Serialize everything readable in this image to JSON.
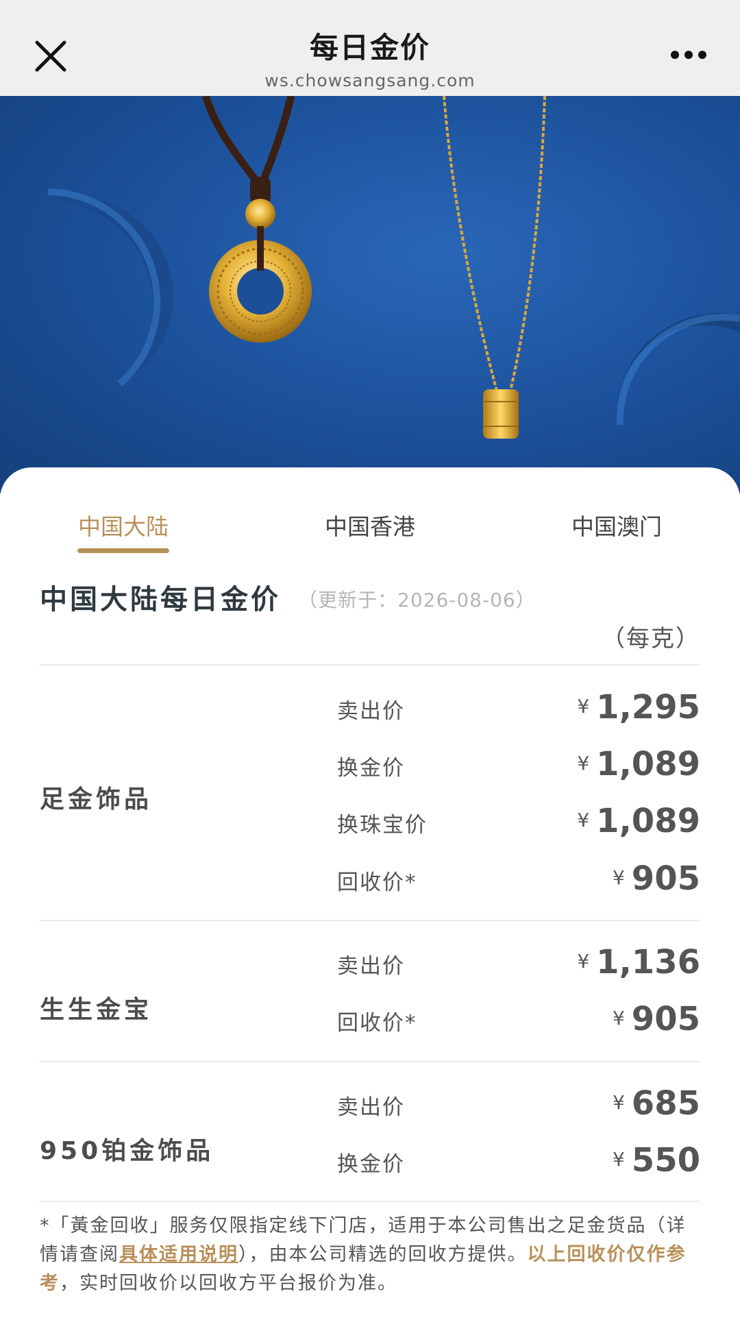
{
  "topbar": {
    "title": "每日金价",
    "url": "ws.chowsangsang.com"
  },
  "tabs": [
    "中国大陆",
    "中国香港",
    "中国澳门"
  ],
  "section": {
    "title": "中国大陆每日金价",
    "update_note": "（更新于：2026-08-06）",
    "unit_note": "（每克）"
  },
  "currency_symbol": "¥",
  "groups": [
    {
      "name": "足金饰品",
      "prices": [
        {
          "label": "卖出价",
          "value": "1,295"
        },
        {
          "label": "换金价",
          "value": "1,089"
        },
        {
          "label": "换珠宝价",
          "value": "1,089"
        },
        {
          "label": "回收价*",
          "value": "905"
        }
      ]
    },
    {
      "name": "生生金宝",
      "prices": [
        {
          "label": "卖出价",
          "value": "1,136"
        },
        {
          "label": "回收价*",
          "value": "905"
        }
      ]
    },
    {
      "name": "950铂金饰品",
      "prices": [
        {
          "label": "卖出价",
          "value": "685"
        },
        {
          "label": "换金价",
          "value": "550"
        }
      ]
    }
  ],
  "footnote": {
    "part1": "*「黃金回收」服务仅限指定线下门店，适用于本公司售出之足金货品（详情请查阅",
    "link": "具体适用说明",
    "part2": "），由本公司精选的回收方提供。",
    "highlight": "以上回收价仅作参考",
    "part3": "，实时回收价以回收方平台报价为准。"
  },
  "colors": {
    "accent": "#b8905a",
    "banner_blue": "#1b4f98"
  },
  "icons": {
    "close": "close-icon",
    "more": "more-icon"
  }
}
